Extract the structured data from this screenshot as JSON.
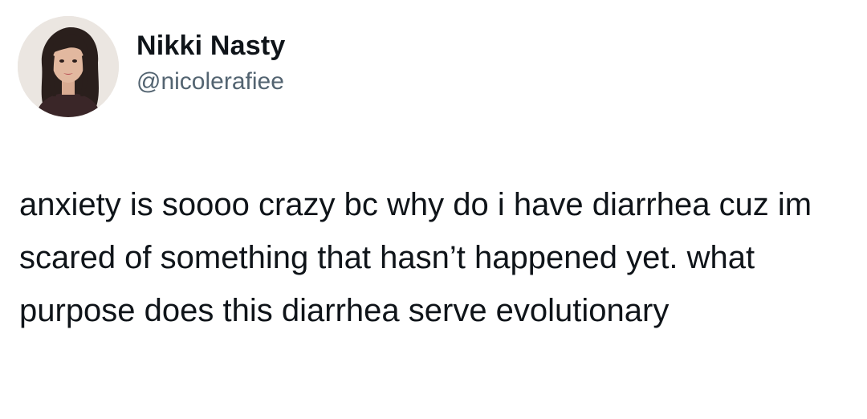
{
  "author": {
    "display_name": "Nikki Nasty",
    "handle": "@nicolerafiee"
  },
  "tweet": {
    "text": "anxiety is soooo crazy bc why do i have diarrhea cuz im scared of something that hasn’t happened yet. what purpose does this diarrhea serve evolutionary"
  },
  "icons": {
    "avatar": "profile-photo"
  }
}
